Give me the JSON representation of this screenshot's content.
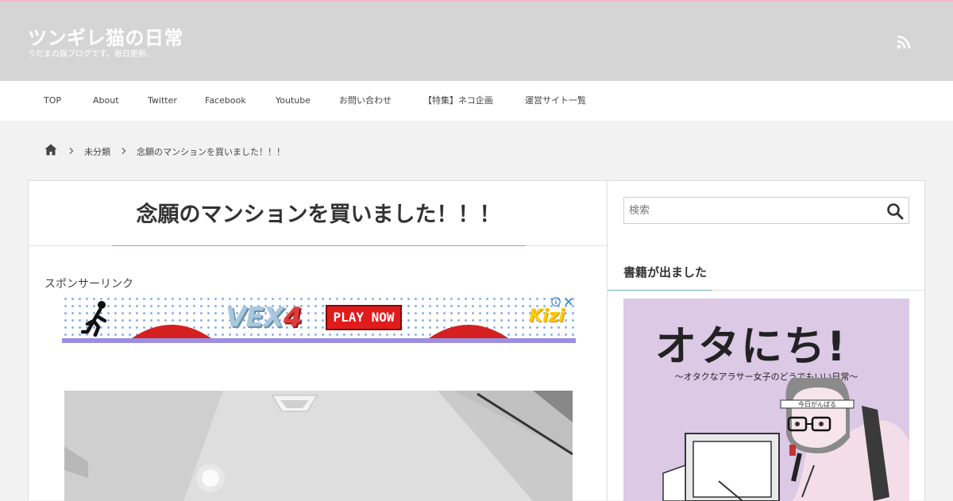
{
  "site": {
    "title": "ツンギレ猫の日常",
    "description": "うだまの猫ブログです。毎日更新。"
  },
  "header": {
    "rss_icon": "rss-icon"
  },
  "nav": {
    "items": [
      {
        "label": "TOP"
      },
      {
        "label": "About"
      },
      {
        "label": "Twitter"
      },
      {
        "label": "Facebook"
      },
      {
        "label": "Youtube"
      },
      {
        "label": "お問い合わせ"
      },
      {
        "label": "【特集】ネコ企画"
      },
      {
        "label": "運営サイト一覧"
      }
    ]
  },
  "breadcrumb": {
    "home_icon": "home-icon",
    "items": [
      "未分類",
      "念願のマンションを買いました！！！"
    ]
  },
  "post": {
    "title": "念願のマンションを買いました！！！",
    "sponsor_label": "スポンサーリンク"
  },
  "ad": {
    "logo_text": "VEX",
    "logo_number": "4",
    "cta_label": "PLAY NOW",
    "brand": "Kizi"
  },
  "sidebar": {
    "search": {
      "placeholder": "検索"
    },
    "widget_title": "書籍が出ました",
    "book": {
      "title": "オタにち!",
      "subtitle": "〜オタクなアラサー女子のどうでもいい日常〜"
    }
  },
  "colors": {
    "header_bg": "#d5d5d5",
    "accent_line": "#6fb3b5",
    "top_line": "#f3b7cc",
    "ad_button": "#e01b1b",
    "book_bg": "#dcc9e6"
  }
}
